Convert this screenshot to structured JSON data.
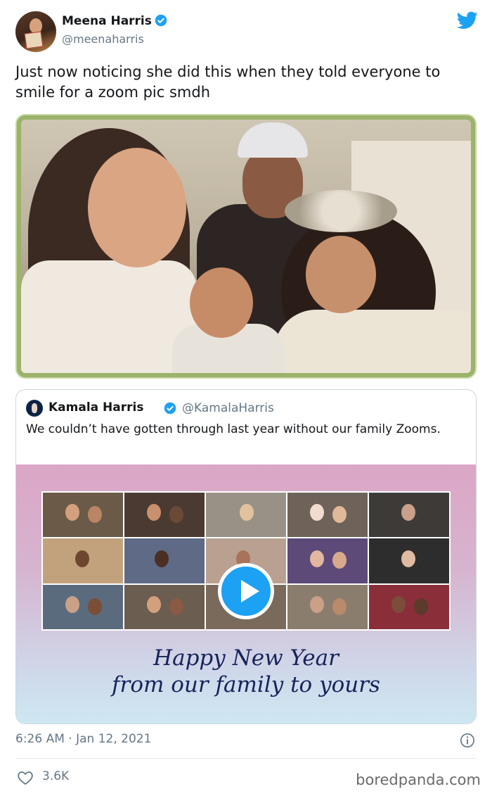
{
  "author": {
    "name": "Meena Harris",
    "handle": "@meenaharris",
    "avatar_icon": "avatar-photo"
  },
  "tweet": {
    "text": "Just now noticing she did this when they told everyone to smile for a zoom pic smdh",
    "timestamp": "6:26 AM · Jan 12, 2021",
    "likes": "3.6K"
  },
  "quoted": {
    "name": "Kamala Harris",
    "handle": "@KamalaHarris",
    "text": "We couldn’t have gotten through last year without our family Zooms.",
    "greeting_line1": "Happy New Year",
    "greeting_line2": "from our family to yours"
  },
  "watermark": "boredpanda.com",
  "colors": {
    "twitter_blue": "#1da1f2",
    "text_primary": "#14171a",
    "text_secondary": "#657786",
    "greeting_navy": "#16235a"
  }
}
